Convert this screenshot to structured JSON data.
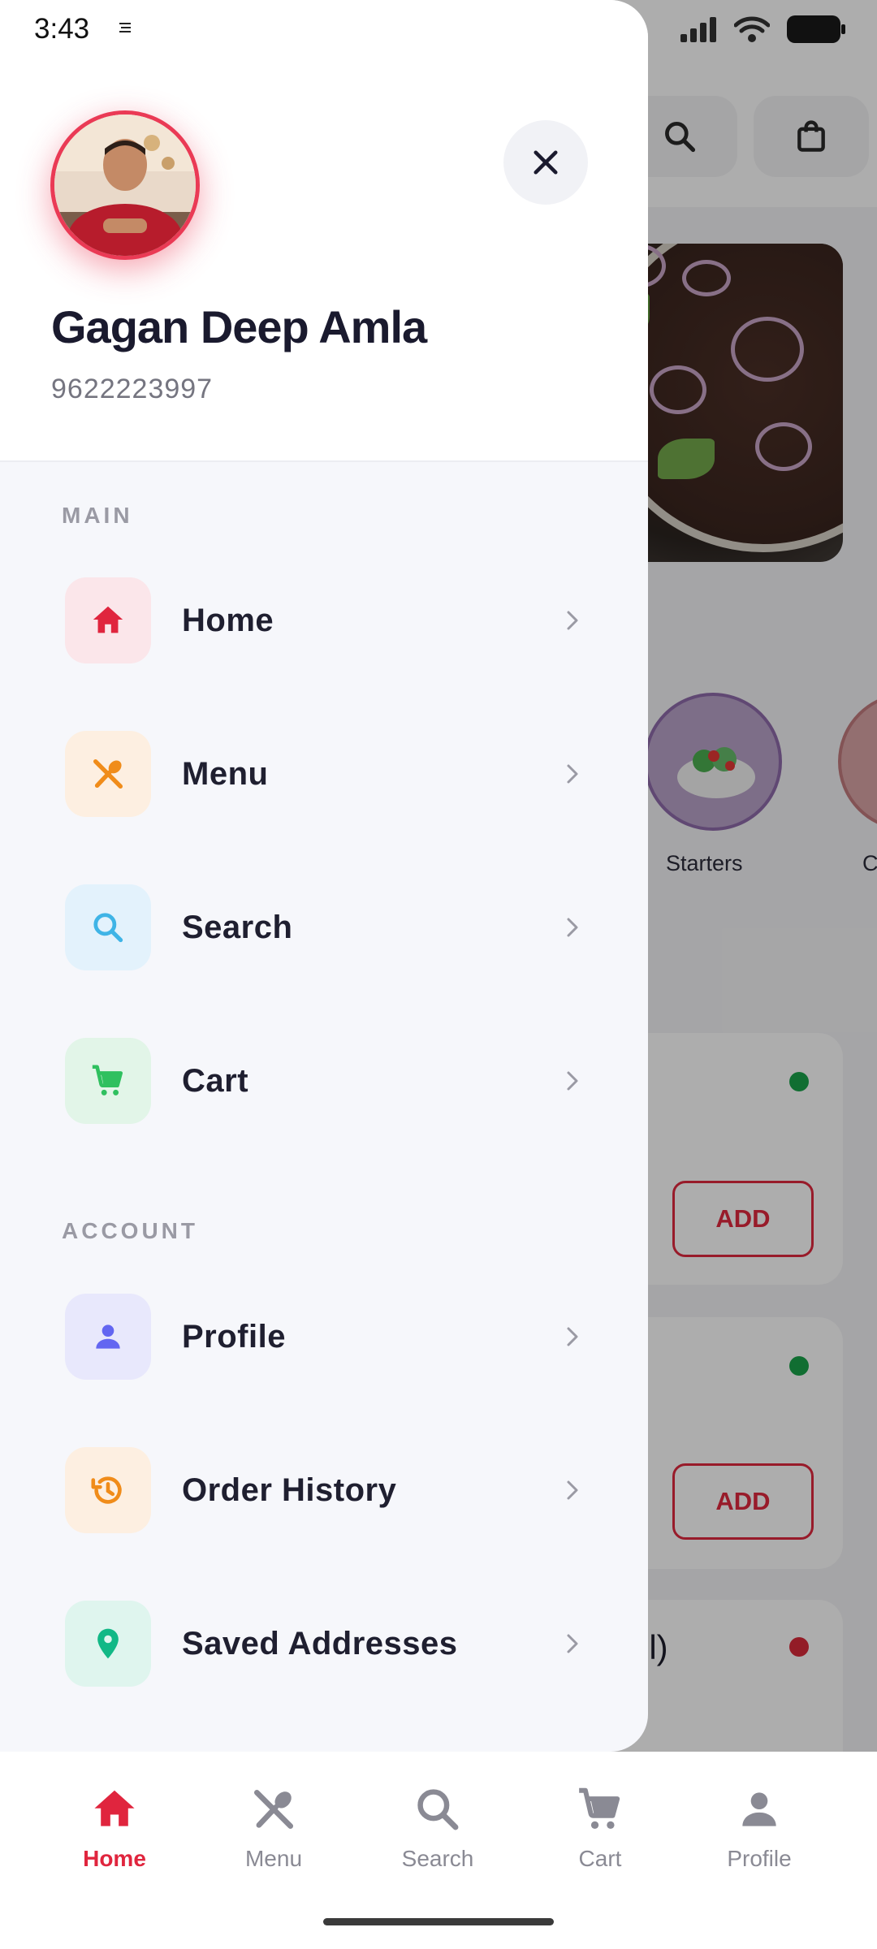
{
  "status_bar": {
    "time": "3:43"
  },
  "drawer": {
    "profile": {
      "name": "Gagan Deep Amla",
      "phone": "9622223997"
    },
    "sections": [
      {
        "label": "MAIN",
        "items": [
          {
            "label": "Home",
            "icon": "home-icon",
            "icon_color": "#e0253e",
            "bg": "#fbe6ea"
          },
          {
            "label": "Menu",
            "icon": "utensils-icon",
            "icon_color": "#f08c1a",
            "bg": "#fdefe1"
          },
          {
            "label": "Search",
            "icon": "search-icon",
            "icon_color": "#3fb4e6",
            "bg": "#e3f2fc"
          },
          {
            "label": "Cart",
            "icon": "cart-icon",
            "icon_color": "#2fc05f",
            "bg": "#e2f5e8"
          }
        ]
      },
      {
        "label": "ACCOUNT",
        "items": [
          {
            "label": "Profile",
            "icon": "person-icon",
            "icon_color": "#6366f1",
            "bg": "#e8e8fc"
          },
          {
            "label": "Order History",
            "icon": "history-icon",
            "icon_color": "#f08c1a",
            "bg": "#fdefe1"
          },
          {
            "label": "Saved Addresses",
            "icon": "location-pin-icon",
            "icon_color": "#12b886",
            "bg": "#dff5ee"
          }
        ]
      }
    ]
  },
  "background": {
    "categories": [
      "Starters",
      "C"
    ],
    "add_button_label": "ADD",
    "partial_text": "ll)"
  },
  "bottom_nav": {
    "items": [
      {
        "label": "Home",
        "icon": "home-icon",
        "active": true
      },
      {
        "label": "Menu",
        "icon": "utensils-icon",
        "active": false
      },
      {
        "label": "Search",
        "icon": "search-icon",
        "active": false
      },
      {
        "label": "Cart",
        "icon": "cart-icon",
        "active": false
      },
      {
        "label": "Profile",
        "icon": "person-icon",
        "active": false
      }
    ]
  },
  "colors": {
    "accent": "#e0253e",
    "inactive": "#8a8a94",
    "veg": "#1aa34a",
    "nonveg": "#d92a3a"
  }
}
